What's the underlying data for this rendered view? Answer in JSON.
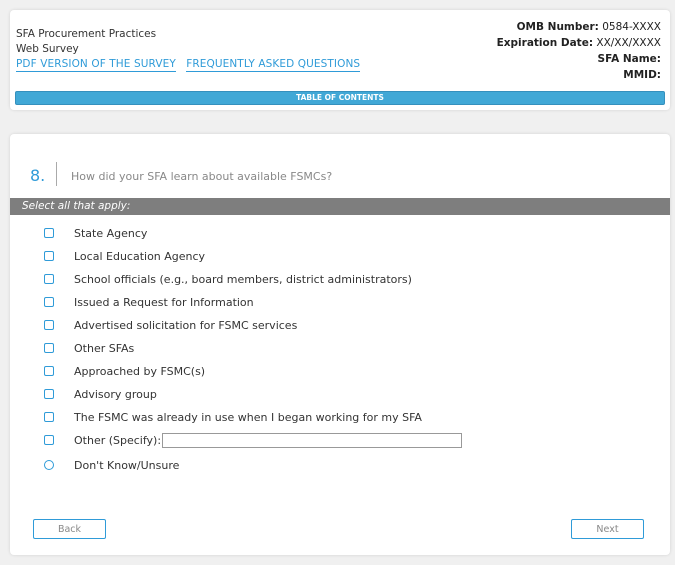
{
  "header": {
    "title_line1": "SFA Procurement Practices",
    "title_line2": "Web Survey",
    "links": {
      "pdf": "PDF VERSION OF THE SURVEY",
      "faq": "FREQUENTLY ASKED QUESTIONS"
    },
    "meta": {
      "omb_label": "OMB Number:",
      "omb_value": "0584-XXXX",
      "exp_label": "Expiration Date:",
      "exp_value": "XX/XX/XXXX",
      "sfa_label": "SFA Name:",
      "mmid_label": "MMID:"
    },
    "toc_label": "TABLE OF CONTENTS"
  },
  "question": {
    "number": "8.",
    "text": "How did your SFA learn about available FSMCs?",
    "instruction": "Select all that apply:",
    "options": [
      "State Agency",
      "Local Education Agency",
      "School officials (e.g., board members, district administrators)",
      "Issued a Request for Information",
      "Advertised solicitation for FSMC services",
      "Other SFAs",
      "Approached by FSMC(s)",
      "Advisory group",
      "The FSMC was already in use when I began working for my SFA",
      "Other (Specify):",
      "Don't Know/Unsure"
    ],
    "specify_value": ""
  },
  "nav": {
    "back": "Back",
    "next": "Next"
  },
  "colors": {
    "accent": "#2f9bd8",
    "toc_bar": "#41a8d6",
    "instruction_bar": "#7e7e7e"
  }
}
